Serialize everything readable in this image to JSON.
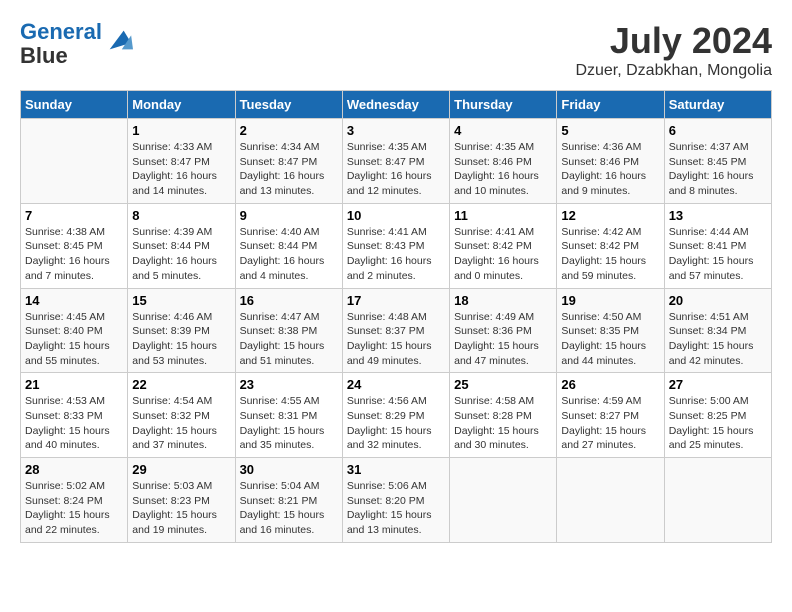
{
  "header": {
    "logo_line1": "General",
    "logo_line2": "Blue",
    "month_title": "July 2024",
    "location": "Dzuer, Dzabkhan, Mongolia"
  },
  "days_of_week": [
    "Sunday",
    "Monday",
    "Tuesday",
    "Wednesday",
    "Thursday",
    "Friday",
    "Saturday"
  ],
  "weeks": [
    [
      {
        "day": "",
        "info": ""
      },
      {
        "day": "1",
        "info": "Sunrise: 4:33 AM\nSunset: 8:47 PM\nDaylight: 16 hours\nand 14 minutes."
      },
      {
        "day": "2",
        "info": "Sunrise: 4:34 AM\nSunset: 8:47 PM\nDaylight: 16 hours\nand 13 minutes."
      },
      {
        "day": "3",
        "info": "Sunrise: 4:35 AM\nSunset: 8:47 PM\nDaylight: 16 hours\nand 12 minutes."
      },
      {
        "day": "4",
        "info": "Sunrise: 4:35 AM\nSunset: 8:46 PM\nDaylight: 16 hours\nand 10 minutes."
      },
      {
        "day": "5",
        "info": "Sunrise: 4:36 AM\nSunset: 8:46 PM\nDaylight: 16 hours\nand 9 minutes."
      },
      {
        "day": "6",
        "info": "Sunrise: 4:37 AM\nSunset: 8:45 PM\nDaylight: 16 hours\nand 8 minutes."
      }
    ],
    [
      {
        "day": "7",
        "info": "Sunrise: 4:38 AM\nSunset: 8:45 PM\nDaylight: 16 hours\nand 7 minutes."
      },
      {
        "day": "8",
        "info": "Sunrise: 4:39 AM\nSunset: 8:44 PM\nDaylight: 16 hours\nand 5 minutes."
      },
      {
        "day": "9",
        "info": "Sunrise: 4:40 AM\nSunset: 8:44 PM\nDaylight: 16 hours\nand 4 minutes."
      },
      {
        "day": "10",
        "info": "Sunrise: 4:41 AM\nSunset: 8:43 PM\nDaylight: 16 hours\nand 2 minutes."
      },
      {
        "day": "11",
        "info": "Sunrise: 4:41 AM\nSunset: 8:42 PM\nDaylight: 16 hours\nand 0 minutes."
      },
      {
        "day": "12",
        "info": "Sunrise: 4:42 AM\nSunset: 8:42 PM\nDaylight: 15 hours\nand 59 minutes."
      },
      {
        "day": "13",
        "info": "Sunrise: 4:44 AM\nSunset: 8:41 PM\nDaylight: 15 hours\nand 57 minutes."
      }
    ],
    [
      {
        "day": "14",
        "info": "Sunrise: 4:45 AM\nSunset: 8:40 PM\nDaylight: 15 hours\nand 55 minutes."
      },
      {
        "day": "15",
        "info": "Sunrise: 4:46 AM\nSunset: 8:39 PM\nDaylight: 15 hours\nand 53 minutes."
      },
      {
        "day": "16",
        "info": "Sunrise: 4:47 AM\nSunset: 8:38 PM\nDaylight: 15 hours\nand 51 minutes."
      },
      {
        "day": "17",
        "info": "Sunrise: 4:48 AM\nSunset: 8:37 PM\nDaylight: 15 hours\nand 49 minutes."
      },
      {
        "day": "18",
        "info": "Sunrise: 4:49 AM\nSunset: 8:36 PM\nDaylight: 15 hours\nand 47 minutes."
      },
      {
        "day": "19",
        "info": "Sunrise: 4:50 AM\nSunset: 8:35 PM\nDaylight: 15 hours\nand 44 minutes."
      },
      {
        "day": "20",
        "info": "Sunrise: 4:51 AM\nSunset: 8:34 PM\nDaylight: 15 hours\nand 42 minutes."
      }
    ],
    [
      {
        "day": "21",
        "info": "Sunrise: 4:53 AM\nSunset: 8:33 PM\nDaylight: 15 hours\nand 40 minutes."
      },
      {
        "day": "22",
        "info": "Sunrise: 4:54 AM\nSunset: 8:32 PM\nDaylight: 15 hours\nand 37 minutes."
      },
      {
        "day": "23",
        "info": "Sunrise: 4:55 AM\nSunset: 8:31 PM\nDaylight: 15 hours\nand 35 minutes."
      },
      {
        "day": "24",
        "info": "Sunrise: 4:56 AM\nSunset: 8:29 PM\nDaylight: 15 hours\nand 32 minutes."
      },
      {
        "day": "25",
        "info": "Sunrise: 4:58 AM\nSunset: 8:28 PM\nDaylight: 15 hours\nand 30 minutes."
      },
      {
        "day": "26",
        "info": "Sunrise: 4:59 AM\nSunset: 8:27 PM\nDaylight: 15 hours\nand 27 minutes."
      },
      {
        "day": "27",
        "info": "Sunrise: 5:00 AM\nSunset: 8:25 PM\nDaylight: 15 hours\nand 25 minutes."
      }
    ],
    [
      {
        "day": "28",
        "info": "Sunrise: 5:02 AM\nSunset: 8:24 PM\nDaylight: 15 hours\nand 22 minutes."
      },
      {
        "day": "29",
        "info": "Sunrise: 5:03 AM\nSunset: 8:23 PM\nDaylight: 15 hours\nand 19 minutes."
      },
      {
        "day": "30",
        "info": "Sunrise: 5:04 AM\nSunset: 8:21 PM\nDaylight: 15 hours\nand 16 minutes."
      },
      {
        "day": "31",
        "info": "Sunrise: 5:06 AM\nSunset: 8:20 PM\nDaylight: 15 hours\nand 13 minutes."
      },
      {
        "day": "",
        "info": ""
      },
      {
        "day": "",
        "info": ""
      },
      {
        "day": "",
        "info": ""
      }
    ]
  ]
}
